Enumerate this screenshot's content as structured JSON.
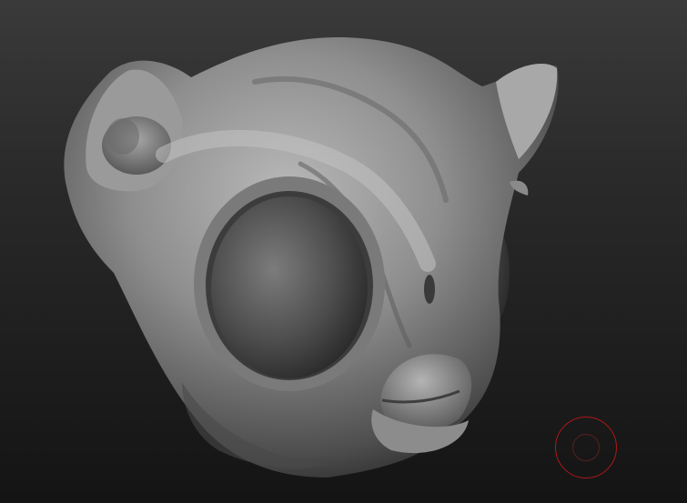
{
  "viewport": {
    "background_top": "#3a3a3a",
    "background_bottom": "#141414",
    "material_color": "#8a8a8a"
  },
  "brush_cursor": {
    "outer_color": "#b01818",
    "inner_color": "#5a2020"
  },
  "model": {
    "icon": "sculpted-creature-head"
  }
}
